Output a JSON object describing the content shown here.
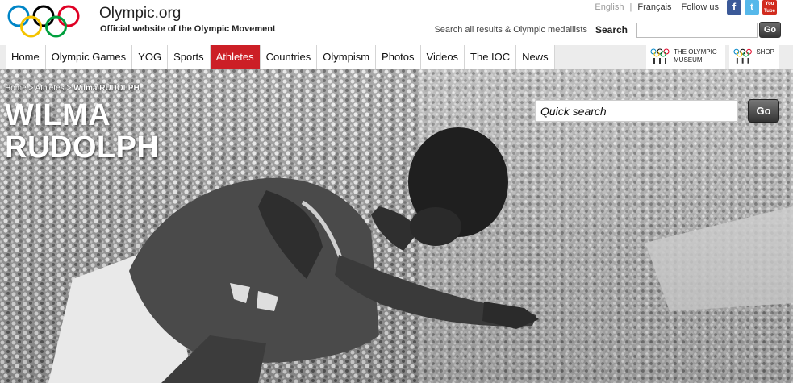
{
  "header": {
    "site_name": "Olympic.org",
    "tagline": "Official website of the Olympic Movement",
    "languages": [
      {
        "label": "English",
        "active": false
      },
      {
        "label": "Français",
        "active": true
      }
    ],
    "follow_label": "Follow us",
    "social": [
      {
        "name": "facebook-icon",
        "glyph": "f"
      },
      {
        "name": "twitter-icon",
        "glyph": "t"
      },
      {
        "name": "youtube-icon",
        "glyph": "You Tube"
      }
    ],
    "search_hint": "Search all results & Olympic medallists",
    "search_label": "Search",
    "search_value": "",
    "search_go": "Go"
  },
  "nav": {
    "items": [
      {
        "label": "Home",
        "active": false
      },
      {
        "label": "Olympic Games",
        "active": false
      },
      {
        "label": "YOG",
        "active": false
      },
      {
        "label": "Sports",
        "active": false
      },
      {
        "label": "Athletes",
        "active": true
      },
      {
        "label": "Countries",
        "active": false
      },
      {
        "label": "Olympism",
        "active": false
      },
      {
        "label": "Photos",
        "active": false
      },
      {
        "label": "Videos",
        "active": false
      },
      {
        "label": "The IOC",
        "active": false
      },
      {
        "label": "News",
        "active": false
      }
    ],
    "museum_line1": "THE OLYMPIC",
    "museum_line2": "MUSEUM",
    "shop_label": "SHOP"
  },
  "hero": {
    "breadcrumb": [
      {
        "label": "Home"
      },
      {
        "label": "Athletes"
      },
      {
        "label": "Wilma RUDOLPH"
      }
    ],
    "name_line1": "WILMA",
    "name_line2": "RUDOLPH",
    "quick_search_placeholder": "Quick search",
    "quick_search_go": "Go"
  },
  "colors": {
    "accent_red": "#cc1f26",
    "ring_blue": "#0085c7",
    "ring_yellow": "#f4c300",
    "ring_black": "#000000",
    "ring_green": "#009f3d",
    "ring_red": "#df0024"
  }
}
